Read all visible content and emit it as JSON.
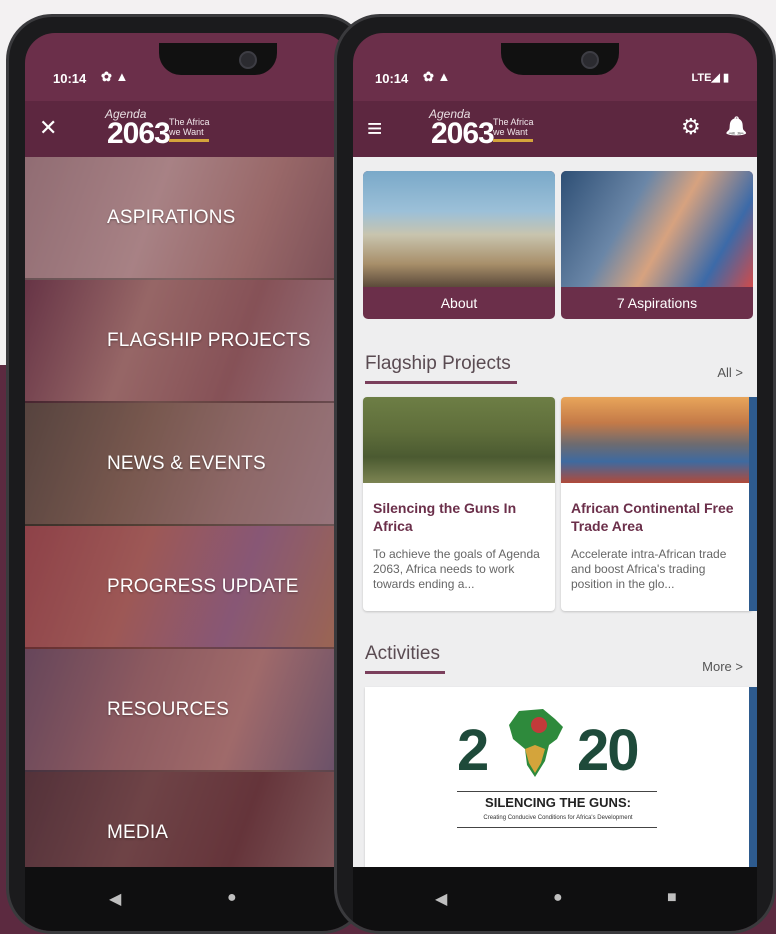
{
  "left_phone": {
    "status": {
      "time": "10:14",
      "icons": "✿ ▲"
    },
    "appbar": {
      "close": "✕"
    },
    "logo": {
      "agenda": "Agenda",
      "year": "2063",
      "tagline": "The Africa we Want"
    },
    "menu": [
      {
        "label": "ASPIRATIONS"
      },
      {
        "label": "FLAGSHIP PROJECTS"
      },
      {
        "label": "NEWS & EVENTS"
      },
      {
        "label": "PROGRESS UPDATE"
      },
      {
        "label": "RESOURCES"
      },
      {
        "label": "MEDIA"
      }
    ],
    "nav": {
      "back": "◀",
      "home": "●"
    }
  },
  "right_phone": {
    "status": {
      "time": "10:14",
      "icons": "✿ ▲",
      "right": "LTE◢ ▮"
    },
    "appbar": {
      "menu": "≡",
      "settings": "⚙",
      "bell": "🔔"
    },
    "logo": {
      "agenda": "Agenda",
      "year": "2063",
      "tagline": "The Africa we Want"
    },
    "top_cards": [
      {
        "label": "About"
      },
      {
        "label": "7 Aspirations"
      }
    ],
    "flagship": {
      "title": "Flagship Projects",
      "link": "All >",
      "cards": [
        {
          "title": "Silencing the Guns In Africa",
          "desc": "To achieve the goals of Agenda 2063, Africa needs to work towards ending a..."
        },
        {
          "title": "African Continental Free Trade Area",
          "desc": "Accelerate intra-African trade and boost Africa's trading position in the glo..."
        }
      ]
    },
    "activities": {
      "title": "Activities",
      "link": "More >",
      "card": {
        "year_left": "2",
        "year_right": "20",
        "heading": "SILENCING THE GUNS:",
        "subheading": "Creating Conducive Conditions for Africa's Development"
      }
    },
    "nav": {
      "back": "◀",
      "home": "●",
      "recent": "■"
    }
  },
  "colors": {
    "maroon": "#6b2f4a",
    "appbar": "#5d2740",
    "accent_gold": "#d4a43b"
  }
}
